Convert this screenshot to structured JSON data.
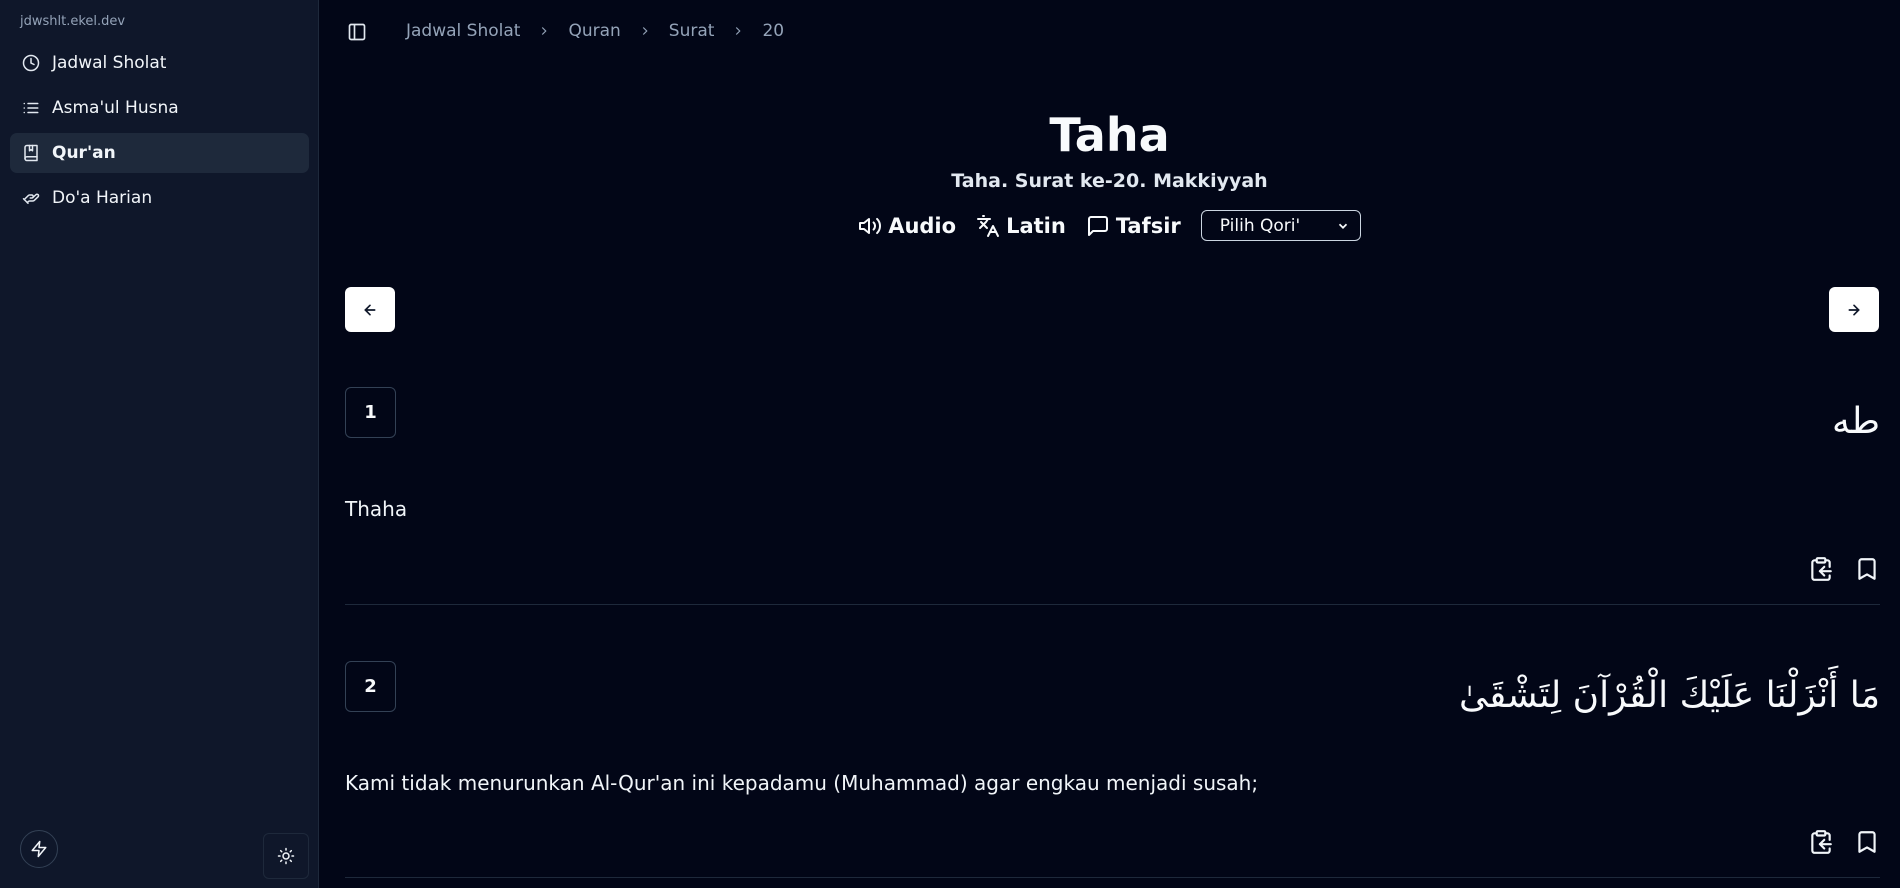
{
  "sidebar": {
    "site_name": "jdwshlt.ekel.dev",
    "items": [
      {
        "label": "Jadwal Sholat",
        "icon": "clock-icon"
      },
      {
        "label": "Asma'ul Husna",
        "icon": "list-icon"
      },
      {
        "label": "Qur'an",
        "icon": "book-icon",
        "active": true
      },
      {
        "label": "Do'a Harian",
        "icon": "praying-hands-icon"
      }
    ]
  },
  "breadcrumb": [
    "Jadwal Sholat",
    "Quran",
    "Surat",
    "20"
  ],
  "surah": {
    "title": "Taha",
    "subtitle": "Taha. Surat ke-20. Makkiyyah"
  },
  "controls": {
    "audio": "Audio",
    "latin": "Latin",
    "tafsir": "Tafsir",
    "qori_selected": "Pilih Qori'"
  },
  "ayat": [
    {
      "number": "1",
      "arabic": "طه",
      "translation": "Thaha"
    },
    {
      "number": "2",
      "arabic": "مَا أَنْزَلْنَا عَلَيْكَ الْقُرْآنَ لِتَشْقَىٰ",
      "translation": "Kami tidak menurunkan Al-Qur'an ini kepadamu (Muhammad) agar engkau menjadi susah;"
    }
  ]
}
